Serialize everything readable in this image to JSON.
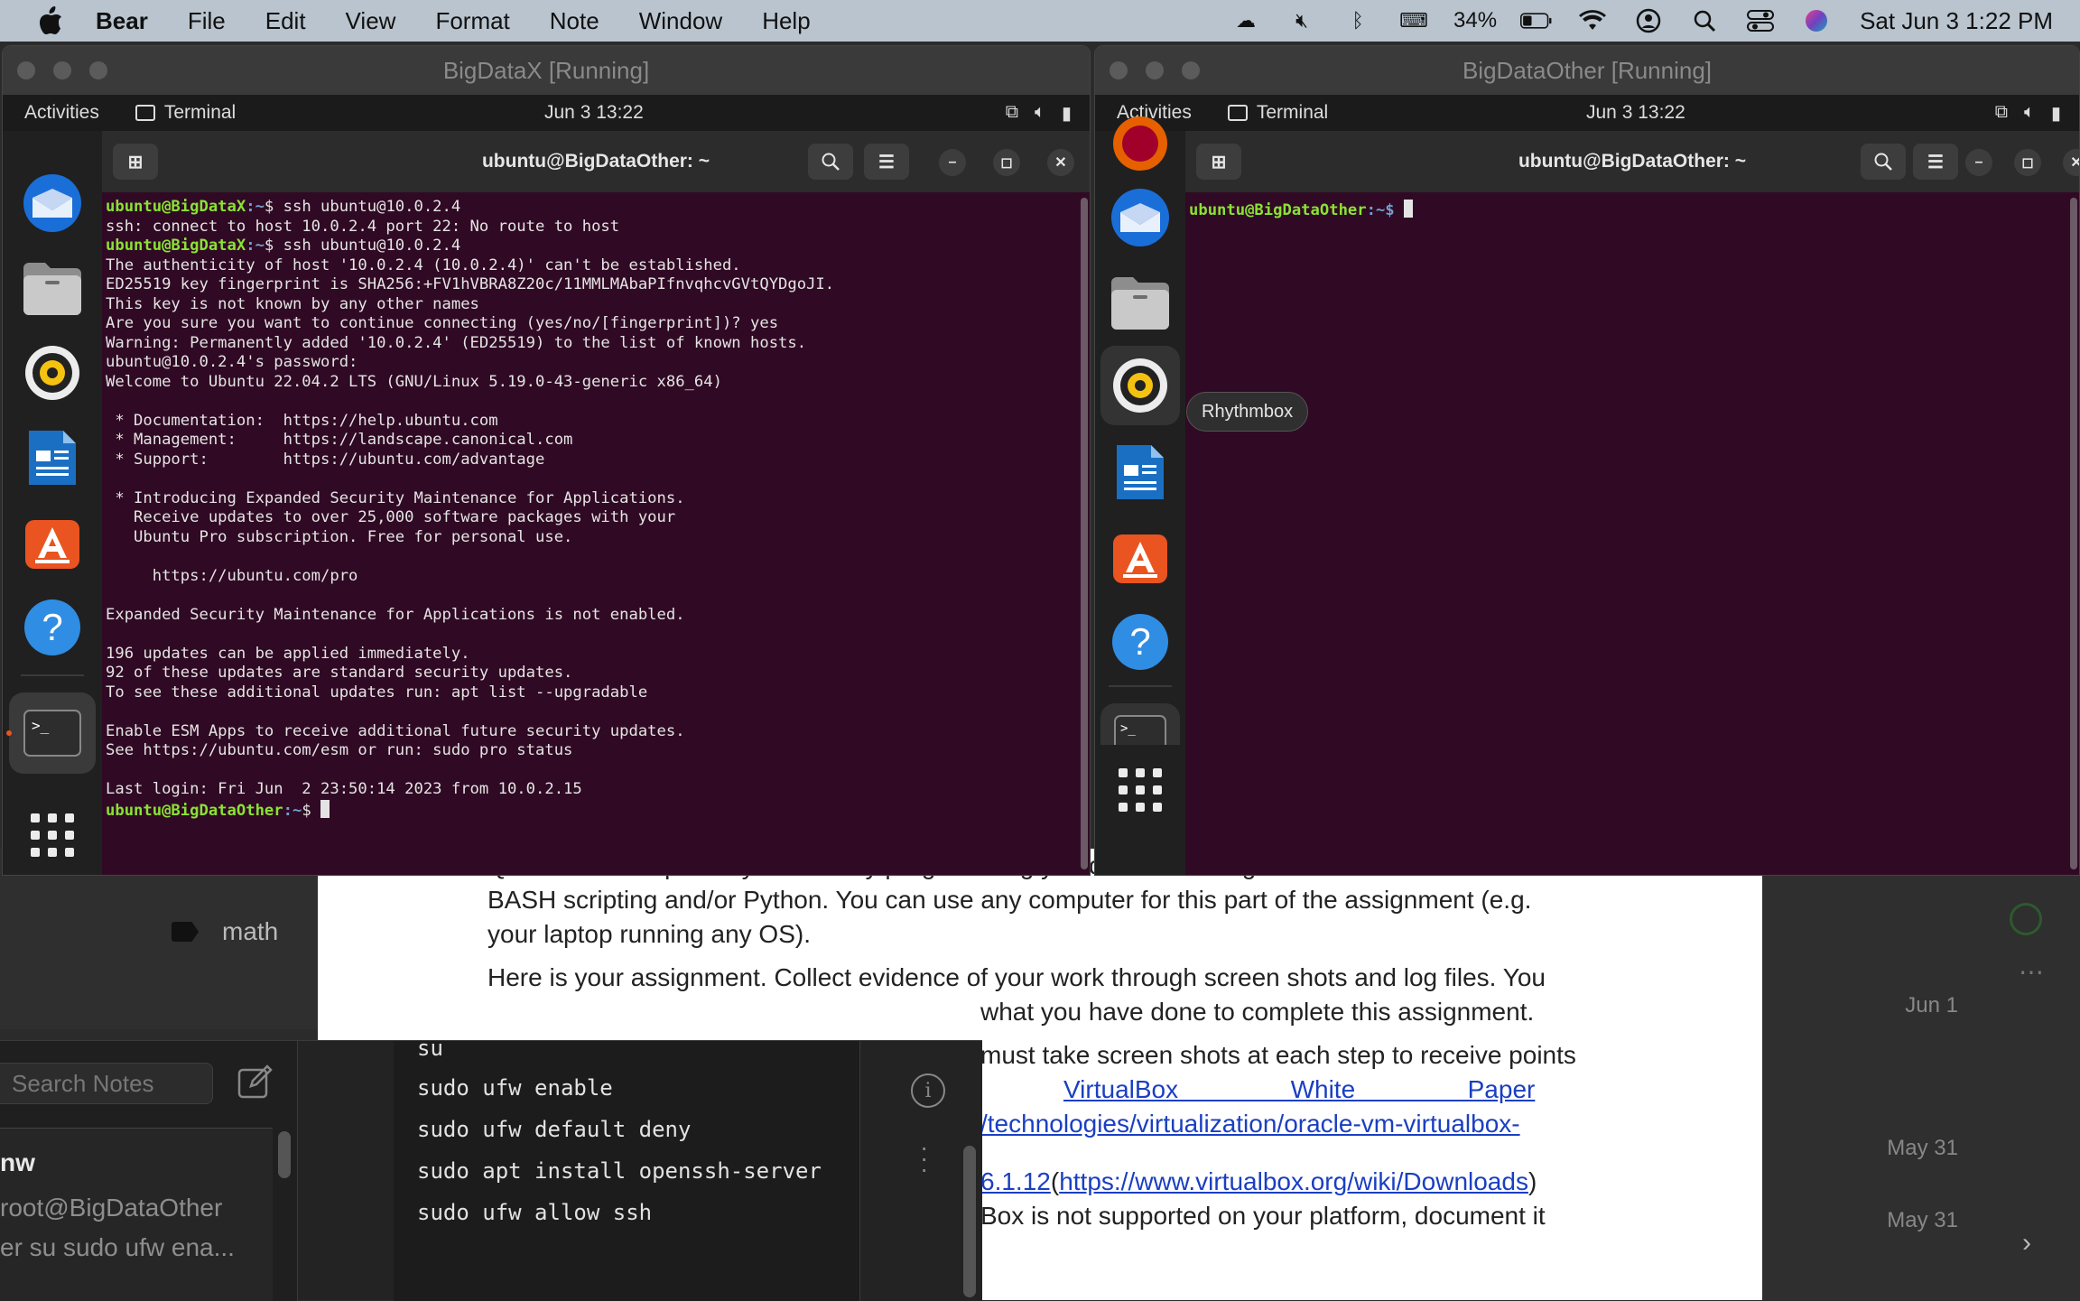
{
  "menubar": {
    "app": "Bear",
    "items": [
      "File",
      "Edit",
      "View",
      "Format",
      "Note",
      "Window",
      "Help"
    ],
    "battery": "34%",
    "datetime": "Sat Jun 3  1:22 PM"
  },
  "bear": {
    "tag": "math",
    "search_placeholder": "Search Notes",
    "note": {
      "title": "nw",
      "line1": "root@BigDataOther",
      "line2": "er su sudo ufw ena..."
    },
    "editor_lines": [
      "su",
      "sudo ufw enable",
      "sudo ufw default deny",
      "sudo apt install openssh-server",
      "sudo ufw allow ssh"
    ],
    "dates": [
      "Jun 1",
      "May 31",
      "May 31"
    ],
    "doc": {
      "p1a": "Q&A about computer systems. Any programming you do in this assignment will be limited to",
      "p1b": "BASH scripting and/or Python. You can use any computer for this part of the assignment (e.g.",
      "p1c": "your laptop running any OS).",
      "p2a": "Here is your assignment. Collect evidence of your work through screen shots and log files. You",
      "p2b": "what you have done to complete this assignment.",
      "p3a": "must take screen shots at each step to receive points",
      "p3b_link": "VirtualBox                White                Paper",
      "p3c_link": "/technologies/virtualization/oracle-vm-virtualbox-",
      "p4_link1": "6.1.12",
      "p4_open": "(",
      "p4_link2": "https://www.virtualbox.org/wiki/Downloads",
      "p4_close": ")",
      "p5": "Box is not supported on your platform, document it"
    }
  },
  "vm1": {
    "title": "BigDataX [Running]",
    "activities": "Activities",
    "app": "Terminal",
    "clock": "Jun 3  13:22",
    "term_title": "ubuntu@BigDataOther: ~"
  },
  "vm2": {
    "title": "BigDataOther [Running]",
    "activities": "Activities",
    "app": "Terminal",
    "clock": "Jun 3  13:22",
    "term_title": "ubuntu@BigDataOther: ~",
    "prompt_user": "ubuntu@BigDataOther",
    "prompt_path": ":~$ ",
    "tooltip": "Rhythmbox"
  },
  "terminal_lines": [
    {
      "p": "ubuntu@BigDataX",
      "t": "ssh ubuntu@10.0.2.4"
    },
    {
      "o": "ssh: connect to host 10.0.2.4 port 22: No route to host"
    },
    {
      "p": "ubuntu@BigDataX",
      "t": "ssh ubuntu@10.0.2.4"
    },
    {
      "o": "The authenticity of host '10.0.2.4 (10.0.2.4)' can't be established."
    },
    {
      "o": "ED25519 key fingerprint is SHA256:+FV1hVBRA8Z20c/11MMLMAbaPIfnvqhcvGVtQYDgoJI."
    },
    {
      "o": "This key is not known by any other names"
    },
    {
      "o": "Are you sure you want to continue connecting (yes/no/[fingerprint])? yes"
    },
    {
      "o": "Warning: Permanently added '10.0.2.4' (ED25519) to the list of known hosts."
    },
    {
      "o": "ubuntu@10.0.2.4's password:"
    },
    {
      "o": "Welcome to Ubuntu 22.04.2 LTS (GNU/Linux 5.19.0-43-generic x86_64)"
    },
    {
      "o": ""
    },
    {
      "o": " * Documentation:  https://help.ubuntu.com"
    },
    {
      "o": " * Management:     https://landscape.canonical.com"
    },
    {
      "o": " * Support:        https://ubuntu.com/advantage"
    },
    {
      "o": ""
    },
    {
      "o": " * Introducing Expanded Security Maintenance for Applications."
    },
    {
      "o": "   Receive updates to over 25,000 software packages with your"
    },
    {
      "o": "   Ubuntu Pro subscription. Free for personal use."
    },
    {
      "o": ""
    },
    {
      "o": "     https://ubuntu.com/pro"
    },
    {
      "o": ""
    },
    {
      "o": "Expanded Security Maintenance for Applications is not enabled."
    },
    {
      "o": ""
    },
    {
      "o": "196 updates can be applied immediately."
    },
    {
      "o": "92 of these updates are standard security updates."
    },
    {
      "o": "To see these additional updates run: apt list --upgradable"
    },
    {
      "o": ""
    },
    {
      "o": "Enable ESM Apps to receive additional future security updates."
    },
    {
      "o": "See https://ubuntu.com/esm or run: sudo pro status"
    },
    {
      "o": ""
    },
    {
      "o": "Last login: Fri Jun  2 23:50:14 2023 from 10.0.2.15"
    },
    {
      "p": "ubuntu@BigDataOther",
      "t": "",
      "cursor": true
    }
  ],
  "colors": {
    "terminal_bg": "#300a24",
    "prompt_user": "#8ae234",
    "prompt_path": "#729fcf",
    "link": "#1a3fc2"
  }
}
